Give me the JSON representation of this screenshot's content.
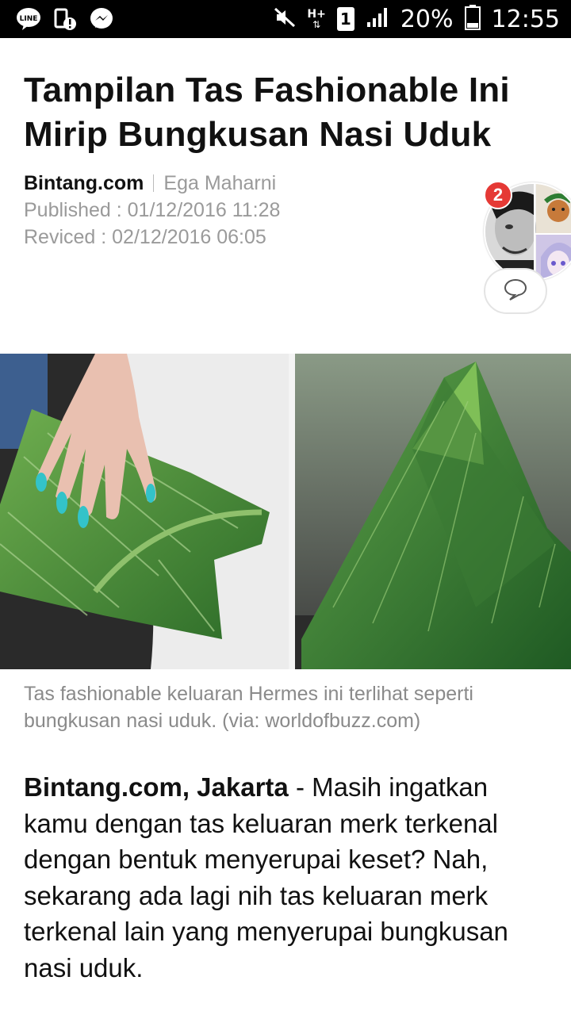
{
  "status_bar": {
    "left_icons": [
      "line-app-icon",
      "device-alert-icon",
      "messenger-icon"
    ],
    "right_icons": [
      "mute-icon",
      "network-h-plus-icon",
      "sim-1-icon",
      "signal-bars-icon",
      "battery-icon"
    ],
    "sim_number": "1",
    "net_label": "H+",
    "battery_percent": "20%",
    "time": "12:55"
  },
  "article": {
    "title": "Tampilan Tas Fashionable Ini Mirip Bungkusan Nasi Uduk",
    "source": "Bintang.com",
    "author": "Ega Maharni",
    "published": "Published : 01/12/2016 11:28",
    "revised": "Reviced : 02/12/2016 06:05",
    "caption": "Tas fashionable keluaran Hermes ini terlihat seperti bungkusan nasi uduk. (via: worldofbuzz.com)",
    "lead_bold": "Bintang.com, Jakarta",
    "lead_text": " - Masih ingatkan kamu dengan tas keluaran merk terkenal dengan bentuk menyerupai keset? Nah, sekarang ada lagi nih tas keluaran merk terkenal lain yang menyerupai bungkusan nasi uduk."
  },
  "social": {
    "comment_count_badge": "2",
    "comment_icon": "speech-bubble-icon"
  },
  "colors": {
    "badge": "#e53935",
    "leaf_green": "#3f8a3a",
    "nail": "#33c3c9"
  }
}
